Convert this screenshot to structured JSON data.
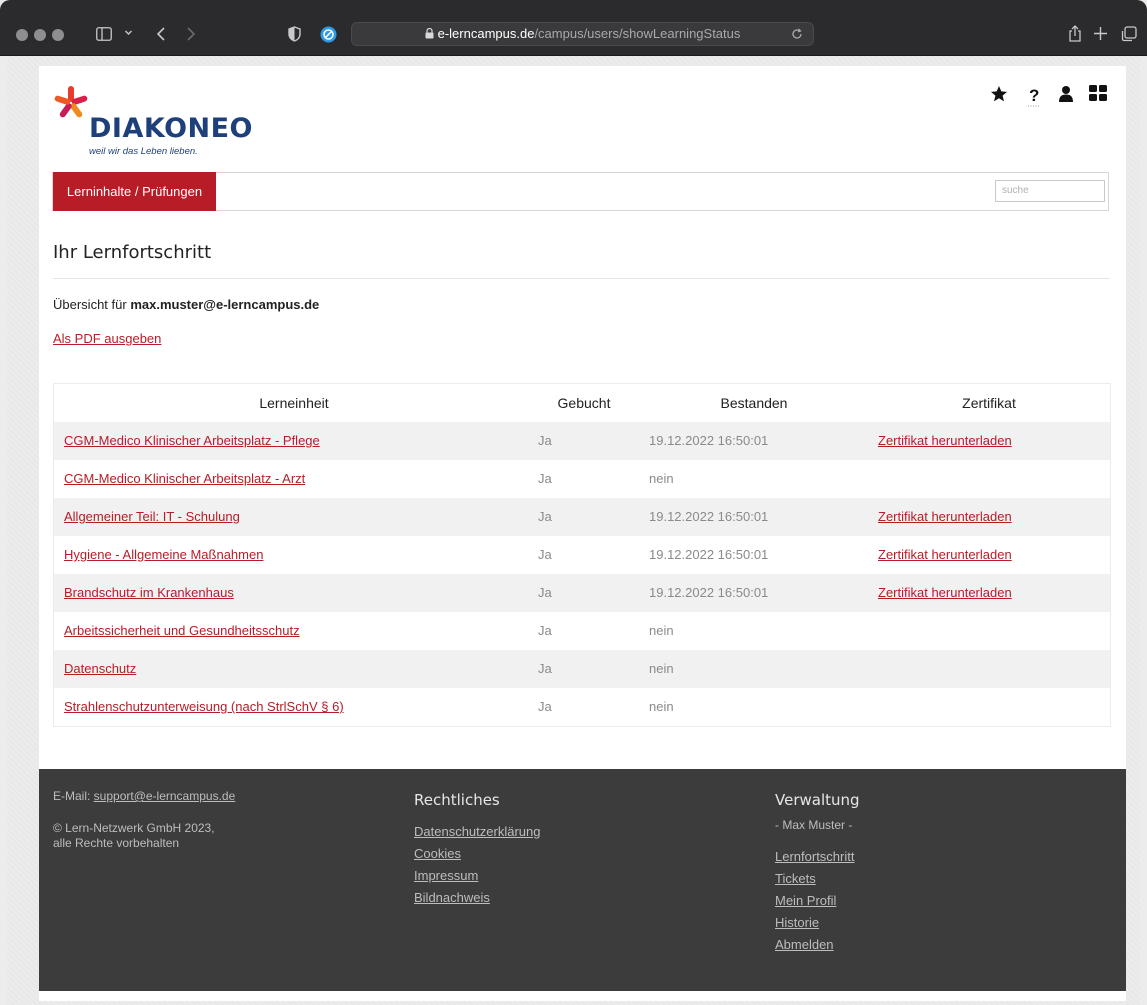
{
  "browser": {
    "host": "e-lerncampus.de",
    "path": "/campus/users/showLearningStatus"
  },
  "logo": {
    "name": "DIAKONEO",
    "tagline": "weil wir das Leben lieben."
  },
  "nav": {
    "tab": "Lerninhalte / Prüfungen",
    "search_placeholder": "suche"
  },
  "page": {
    "title": "Ihr Lernfortschritt",
    "overview_prefix": "Übersicht für ",
    "overview_email": "max.muster@e-lerncampus.de",
    "pdf_link": "Als PDF ausgeben"
  },
  "table": {
    "headers": [
      "Lerneinheit",
      "Gebucht",
      "Bestanden",
      "Zertifikat"
    ],
    "rows": [
      {
        "unit": "CGM-Medico Klinischer Arbeitsplatz - Pflege",
        "booked": "Ja",
        "passed": "19.12.2022 16:50:01",
        "cert": "Zertifikat herunterladen"
      },
      {
        "unit": "CGM-Medico Klinischer Arbeitsplatz - Arzt",
        "booked": "Ja",
        "passed": "nein",
        "cert": ""
      },
      {
        "unit": "Allgemeiner Teil: IT - Schulung",
        "booked": "Ja",
        "passed": "19.12.2022 16:50:01",
        "cert": "Zertifikat herunterladen"
      },
      {
        "unit": "Hygiene - Allgemeine Maßnahmen",
        "booked": "Ja",
        "passed": "19.12.2022 16:50:01",
        "cert": "Zertifikat herunterladen"
      },
      {
        "unit": "Brandschutz im Krankenhaus",
        "booked": "Ja",
        "passed": "19.12.2022 16:50:01",
        "cert": "Zertifikat herunterladen"
      },
      {
        "unit": "Arbeitssicherheit und Gesundheitsschutz",
        "booked": "Ja",
        "passed": "nein",
        "cert": ""
      },
      {
        "unit": "Datenschutz",
        "booked": "Ja",
        "passed": "nein",
        "cert": ""
      },
      {
        "unit": "Strahlenschutzunterweisung (nach StrlSchV § 6)",
        "booked": "Ja",
        "passed": "nein",
        "cert": ""
      }
    ]
  },
  "footer": {
    "email_label": "E-Mail: ",
    "email": "support@e-lerncampus.de",
    "copyright_line1": "© Lern-Netzwerk GmbH 2023,",
    "copyright_line2": "alle Rechte vorbehalten",
    "legal": {
      "title": "Rechtliches",
      "links": [
        "Datenschutzerklärung",
        "Cookies",
        "Impressum",
        "Bildnachweis"
      ]
    },
    "admin": {
      "title": "Verwaltung",
      "user": "- Max Muster -",
      "links": [
        "Lernfortschritt",
        "Tickets",
        "Mein Profil",
        "Historie",
        "Abmelden"
      ]
    }
  },
  "colors": {
    "brand_red": "#b61d27",
    "brand_blue": "#1d3f7a",
    "footer_bg": "#3c3c3c"
  },
  "icons": [
    "star-icon",
    "help-icon",
    "user-icon",
    "grid-icon"
  ]
}
